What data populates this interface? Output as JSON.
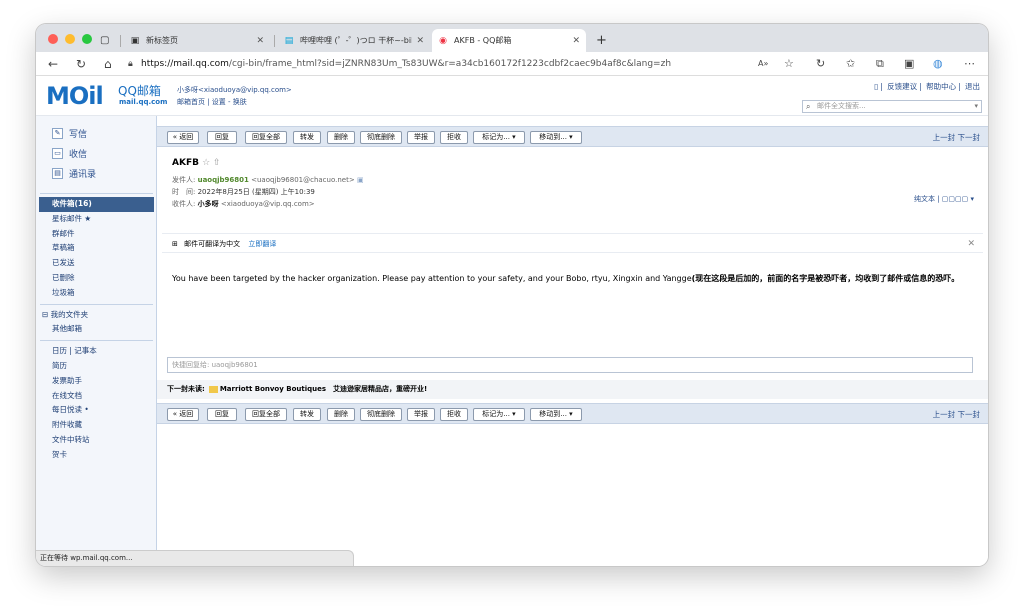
{
  "browser": {
    "tabs": [
      {
        "icon": "new-tab-icon",
        "title": "新标签页"
      },
      {
        "icon": "bilibili-icon",
        "title": "哔哩哔哩 (゜-゜)つロ 干杯~-bili"
      },
      {
        "icon": "qqmail-icon",
        "title": "AKFB - QQ邮箱"
      }
    ],
    "url_domain": "https://mail.qq.com",
    "url_path": "/cgi-bin/frame_html?sid=jZNRN83Um_Ts83UW&r=a34cb160172f1223cdbf2caec9b4af8c&lang=zh"
  },
  "header": {
    "logo_text": "MOil",
    "logo_name": "QQ邮箱",
    "logo_domain": "mail.qq.com",
    "user": "小多呀<xiaoduoya@vip.qq.com>",
    "user_links": "邮箱首页 | 设置 - 换肤",
    "top_links": [
      "反馈建议",
      "帮助中心",
      "退出"
    ],
    "search_placeholder": "邮件全文搜索..."
  },
  "sidebar": {
    "quick": [
      "写信",
      "收信",
      "通讯录"
    ],
    "folders": [
      "收件箱(16)",
      "星标邮件 ★",
      "群邮件",
      "草稿箱",
      "已发送",
      "已删除",
      "垃圾箱"
    ],
    "my_folders": [
      "⊟ 我的文件夹",
      "其他邮箱"
    ],
    "apps": [
      "日历 | 记事本",
      "简历",
      "发票助手",
      "在线文档",
      "每日悦读 •",
      "附件收藏",
      "文件中转站",
      "贺卡"
    ]
  },
  "toolbar": {
    "back": "« 返回",
    "reply": "回复",
    "reply_all": "回复全部",
    "forward": "转发",
    "delete": "删除",
    "delete_perm": "彻底删除",
    "report": "举报",
    "reject": "拒收",
    "mark_as": "标记为... ▾",
    "move_to": "移动到... ▾",
    "prev_next": "上一封 下一封"
  },
  "mail": {
    "subject": "AKFB",
    "star": "☆ ⇧",
    "from_label": "发件人:",
    "from_name": "uaoqjb96801",
    "from_email": "<uaoqjb96801@chacuo.net>",
    "time_label": "时　间:",
    "time": "2022年8月25日 (星期四) 上午10:39",
    "to_label": "收件人:",
    "to_name": "小多呀",
    "to_email": "<xiaoduoya@vip.qq.com>",
    "tools": "纯文本 | ▢▢▢▢ ▾",
    "translate_text": "邮件可翻译为中文",
    "translate_link": "立即翻译",
    "body": "You have been targeted by the hacker organization. Please pay attention to your safety, and your Bobo, rtyu, Xingxin and Yangge",
    "body_note": "(现在这段是后加的，前面的名字是被恐吓者，均收到了邮件或信息的恐吓。",
    "quick_reply_placeholder": "快捷回复给: uaoqjb96801",
    "next_unread_label": "下一封未读:",
    "next_unread_subject": "Marriott Bonvoy Boutiques　艾迪逊家居精品店，重磅开业!"
  },
  "status": "正在等待 wp.mail.qq.com..."
}
